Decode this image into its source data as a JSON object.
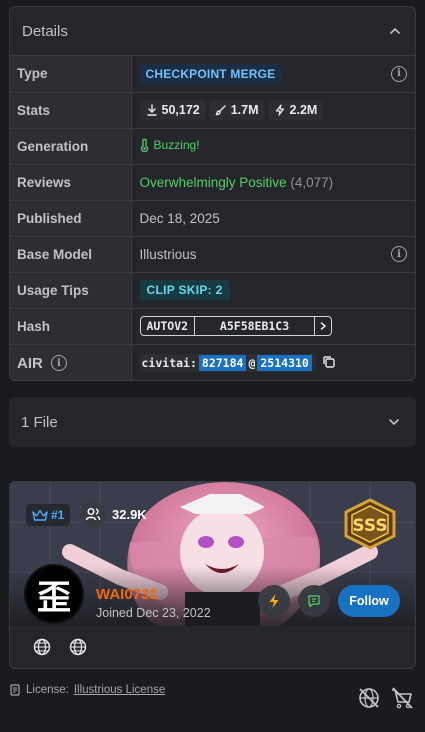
{
  "details": {
    "title": "Details",
    "rows": {
      "type_label": "Type",
      "type_value": "CHECKPOINT MERGE",
      "stats_label": "Stats",
      "stats_downloads": "50,172",
      "stats_generations": "1.7M",
      "stats_buzz": "2.2M",
      "generation_label": "Generation",
      "generation_value": "Buzzing!",
      "reviews_label": "Reviews",
      "reviews_value": "Overwhelmingly Positive",
      "reviews_count": "(4,077)",
      "published_label": "Published",
      "published_value": "Dec 18, 2025",
      "base_model_label": "Base Model",
      "base_model_value": "Illustrious",
      "usage_tips_label": "Usage Tips",
      "usage_tips_value": "CLIP SKIP: 2",
      "hash_label": "Hash",
      "hash_algo": "AUTOV2",
      "hash_value": "A5F58EB1C3",
      "air_label": "AIR",
      "air_prefix": "civitai:",
      "air_model_id": "827184",
      "air_at": "@",
      "air_version_id": "2514310"
    }
  },
  "files": {
    "label": "1 File"
  },
  "creator": {
    "rank": "#1",
    "followers": "32.9K",
    "badge_text": "SSS",
    "avatar_glyph": "歪",
    "username": "WAI0731",
    "joined": "Joined Dec 23, 2022",
    "follow_label": "Follow"
  },
  "license": {
    "prefix": "License:",
    "link": "Illustrious License"
  },
  "colors": {
    "accent_blue": "#1971c2",
    "username_orange": "#f76707",
    "positive_green": "#51cf66"
  }
}
